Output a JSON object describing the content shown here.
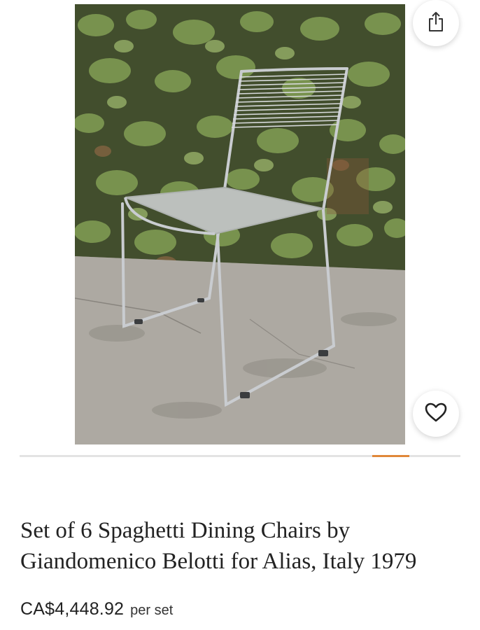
{
  "product": {
    "title": "Set of 6 Spaghetti Dining Chairs by Giandomenico Belotti for Alias, Italy 1979",
    "price": "CA$4,448.92",
    "price_unit": "per set"
  },
  "gallery": {
    "image_description": "product-photo",
    "progress_fraction": 0.084,
    "progress_position_fraction": 0.8,
    "share_icon": "share-icon",
    "favorite_icon": "heart-icon"
  },
  "colors": {
    "accent": "#e0883a",
    "track": "#e3e3e3",
    "text": "#222222"
  }
}
